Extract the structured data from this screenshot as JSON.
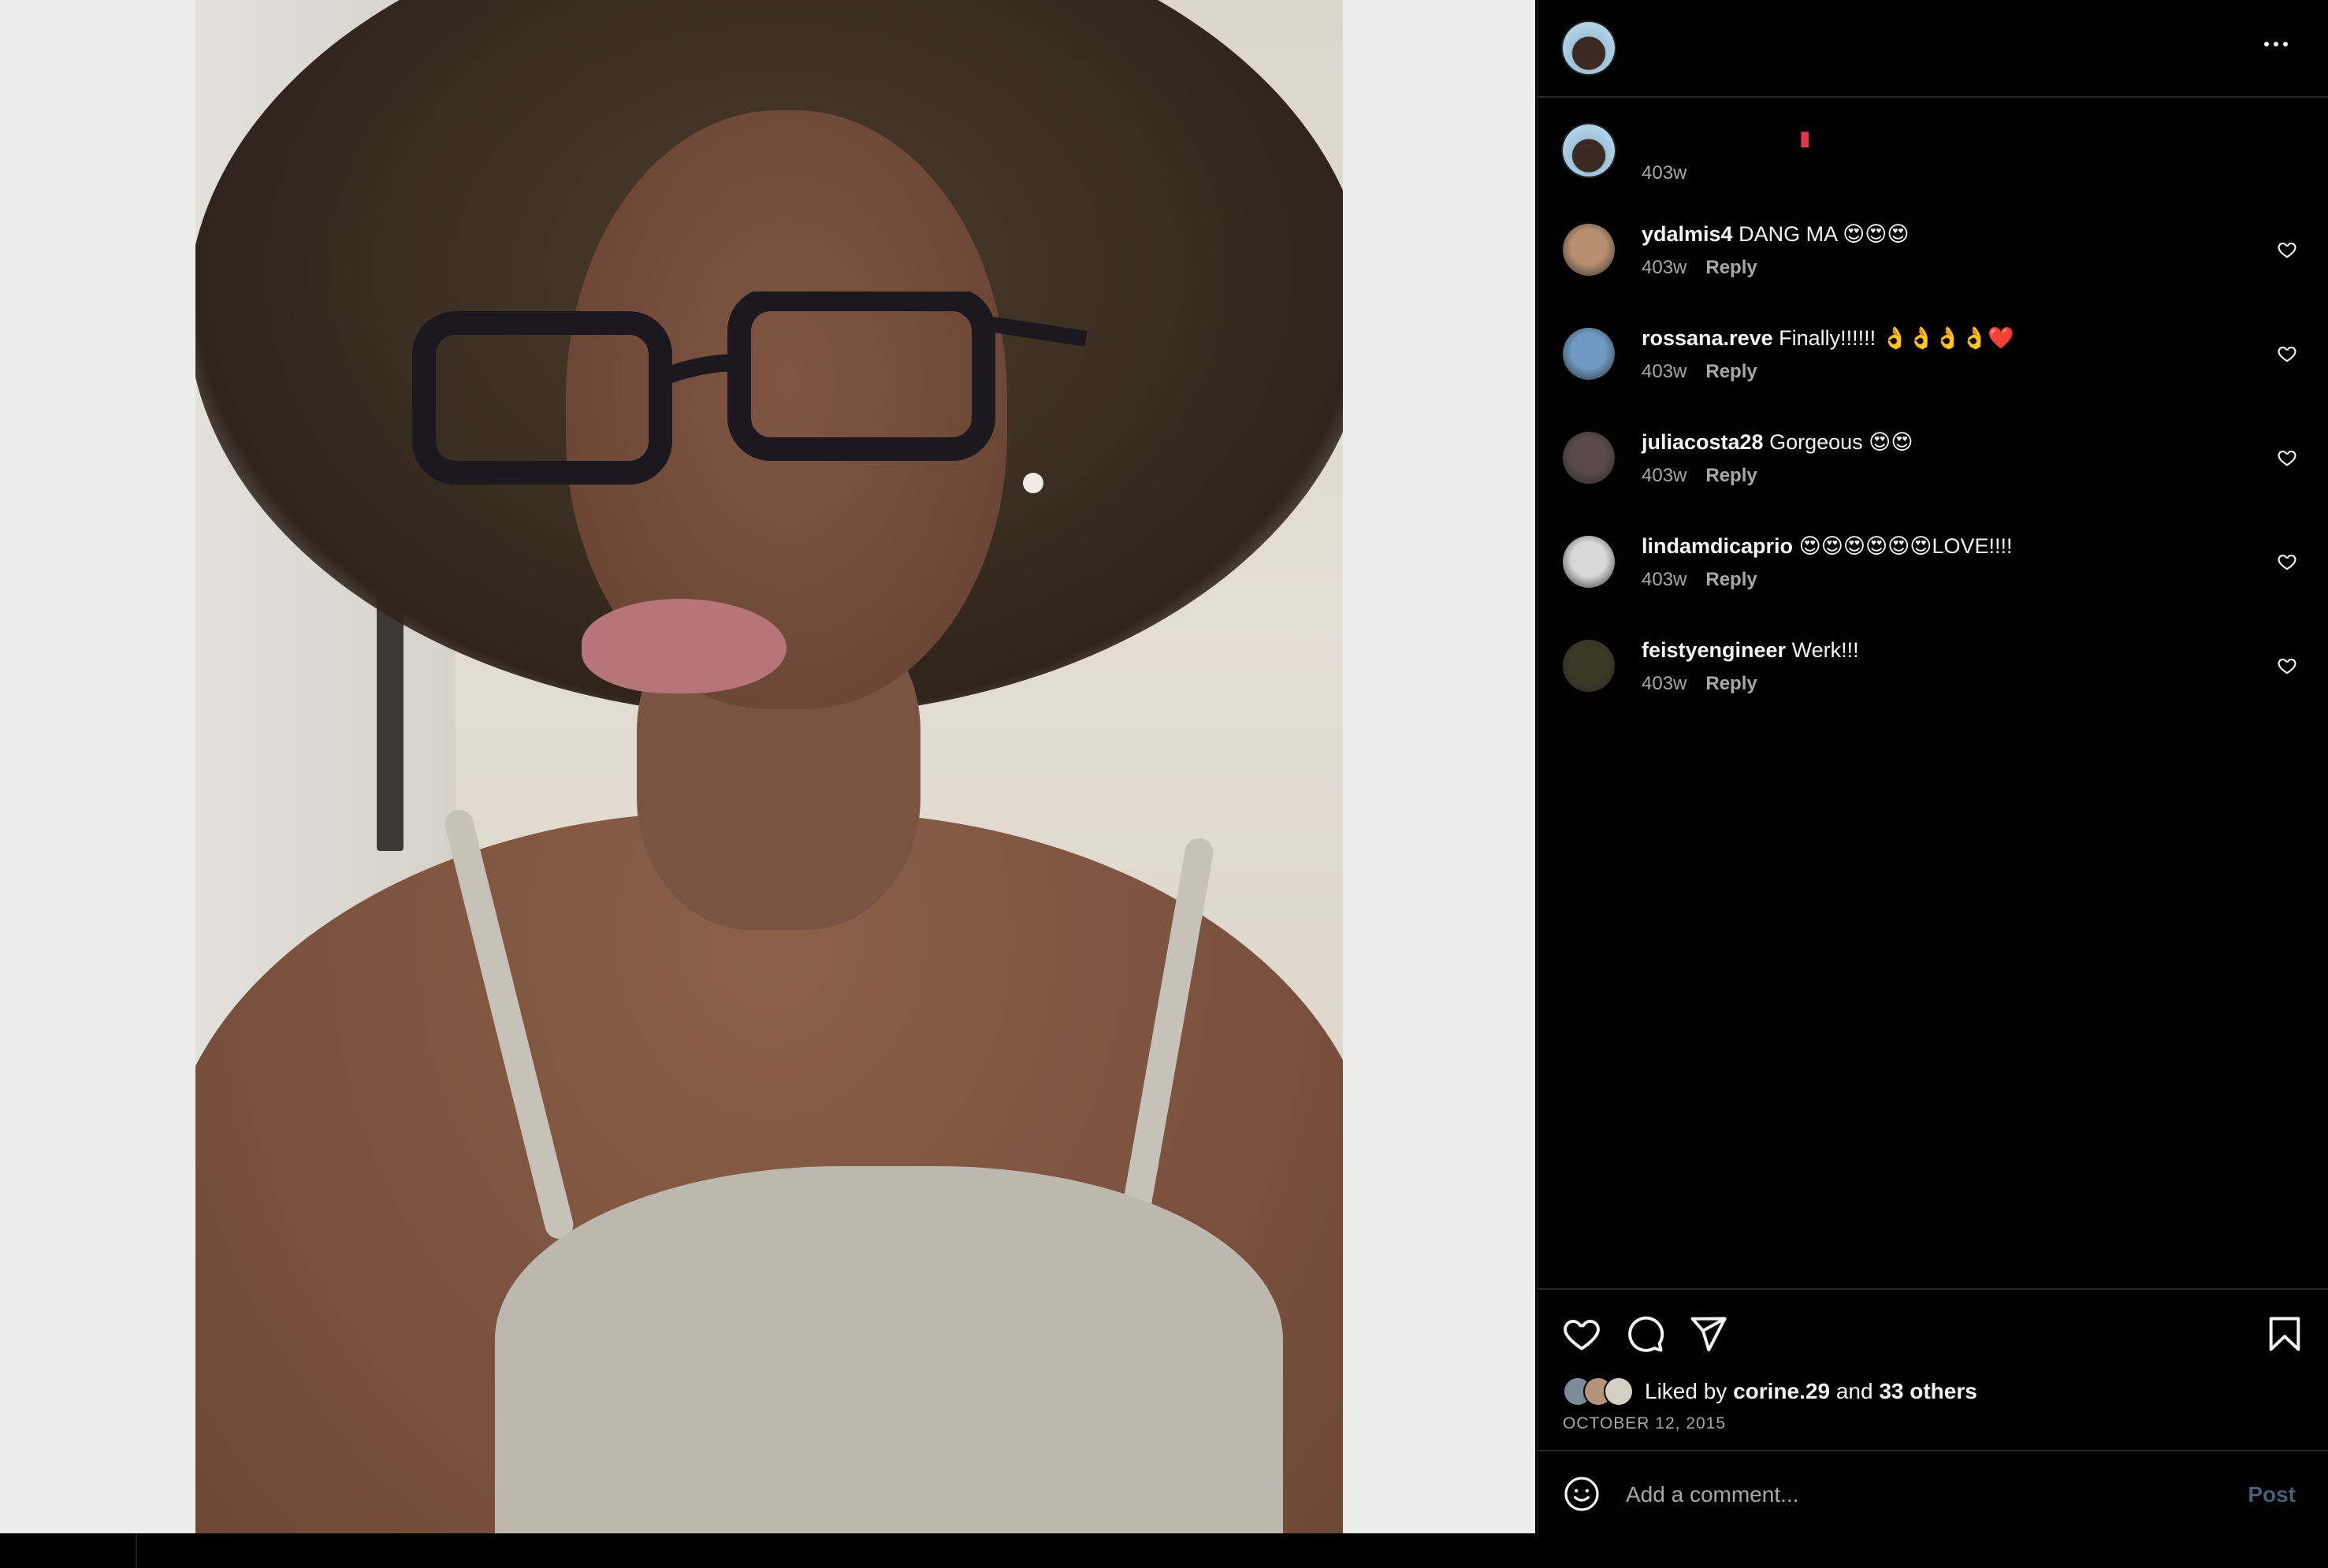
{
  "post": {
    "caption_time": "403w",
    "caption_icon": "lipstick-icon"
  },
  "comments": [
    {
      "user": "ydalmis4",
      "text": "DANG MA 😍😍😍",
      "time": "403w",
      "reply": "Reply",
      "avatar_color": "#b89070"
    },
    {
      "user": "rossana.reve",
      "text": "Finally!!!!!! 👌👌👌👌❤️",
      "time": "403w",
      "reply": "Reply",
      "avatar_color": "#6f9bc2"
    },
    {
      "user": "juliacosta28",
      "text": "Gorgeous 😍😍",
      "time": "403w",
      "reply": "Reply",
      "avatar_color": "#5a4a48"
    },
    {
      "user": "lindamdicaprio",
      "text": "😍😍😍😍😍😍LOVE!!!!",
      "time": "403w",
      "reply": "Reply",
      "avatar_color": "#d8d8d8"
    },
    {
      "user": "feistyengineer",
      "text": "Werk!!!",
      "time": "403w",
      "reply": "Reply",
      "avatar_color": "#3d3a24"
    }
  ],
  "likes": {
    "prefix": "Liked by",
    "user": "corine.29",
    "and": "and",
    "others": "33 others",
    "date": "OCTOBER 12, 2015"
  },
  "comment_box": {
    "placeholder": "Add a comment...",
    "post_label": "Post"
  },
  "colors": {
    "background": "#000000",
    "muted_text": "#a8a8a8",
    "post_button_disabled": "#4a5d78",
    "divider": "#262626"
  }
}
